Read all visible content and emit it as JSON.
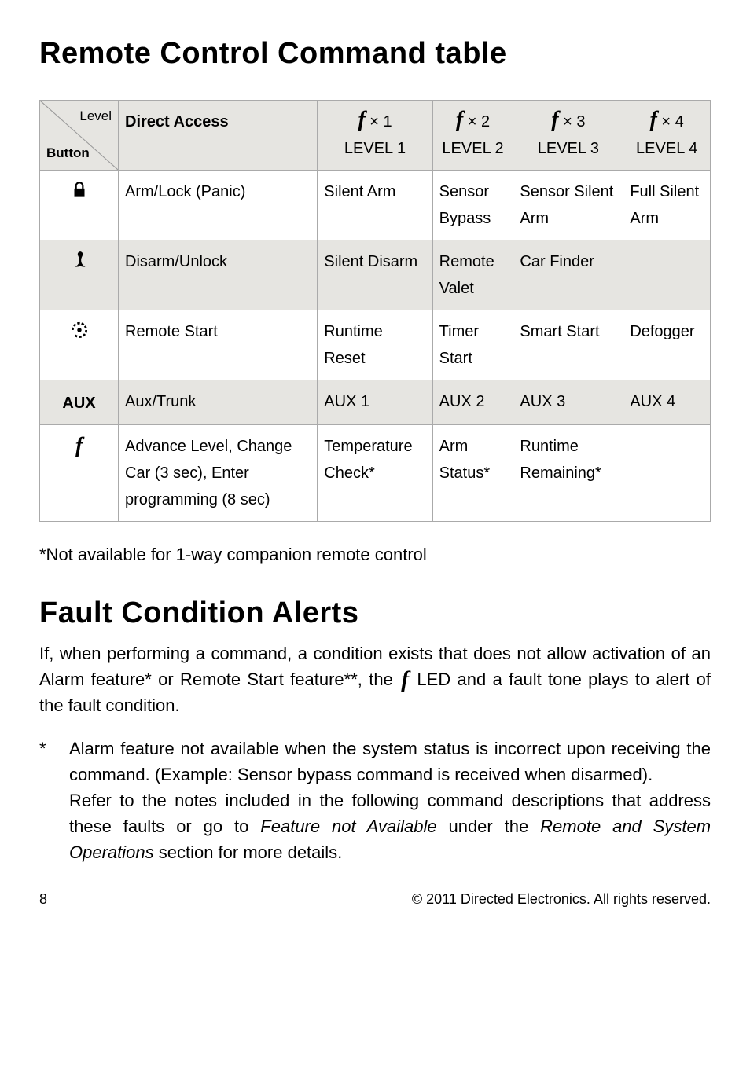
{
  "heading1": "Remote Control Command table",
  "corner": {
    "top": "Level",
    "bottom": "Button"
  },
  "col_headers": {
    "direct": "Direct Access",
    "l1_sym": "× 1",
    "l1_text": "LEVEL 1",
    "l2_sym": "× 2",
    "l2_text": "LEVEL 2",
    "l3_sym": "× 3",
    "l3_text": "LEVEL 3",
    "l4_sym": "× 4",
    "l4_text": "LEVEL 4"
  },
  "rows": {
    "lock": {
      "c1": "Arm/Lock (Panic)",
      "c2": "Silent Arm",
      "c3": "Sensor Bypass",
      "c4": "Sensor Silent Arm",
      "c5": "Full Silent Arm"
    },
    "unlock": {
      "c1": "Disarm/Unlock",
      "c2": "Silent Disarm",
      "c3": "Remote Valet",
      "c4": "Car Finder",
      "c5": ""
    },
    "start": {
      "c1": "Remote Start",
      "c2": "Runtime Reset",
      "c3": "Timer Start",
      "c4": "Smart Start",
      "c5": "Defogger"
    },
    "aux": {
      "label": "AUX",
      "c1": "Aux/Trunk",
      "c2": "AUX 1",
      "c3": "AUX 2",
      "c4": "AUX 3",
      "c5": "AUX 4"
    },
    "f": {
      "c1": "Advance Level, Change Car (3 sec), Enter programming (8 sec)",
      "c2": "Temperature Check*",
      "c3": "Arm Status*",
      "c4": "Runtime Remaining*",
      "c5": ""
    }
  },
  "table_note": "*Not available for 1-way companion remote control",
  "heading2": "Fault Condition Alerts",
  "fault_p_a": "If, when performing a command, a condition exists that does not allow activation of an Alarm feature* or Remote Start feature**, the ",
  "fault_p_b": " LED and a fault tone plays to alert of the fault condition.",
  "foot1_mark": "*",
  "foot1_text_a": "Alarm feature not available when the system status is incorrect upon receiving the command. (Example: Sensor bypass command is received when disarmed).",
  "foot1_text_b": "Refer to the notes included in the following command descriptions that address these faults or go to ",
  "foot1_italic1": "Feature not Available",
  "foot1_text_c": " under the ",
  "foot1_italic2": "Remote and System Operations",
  "foot1_text_d": " section for more details.",
  "page_number": "8",
  "copyright": "© 2011 Directed Electronics. All rights reserved."
}
